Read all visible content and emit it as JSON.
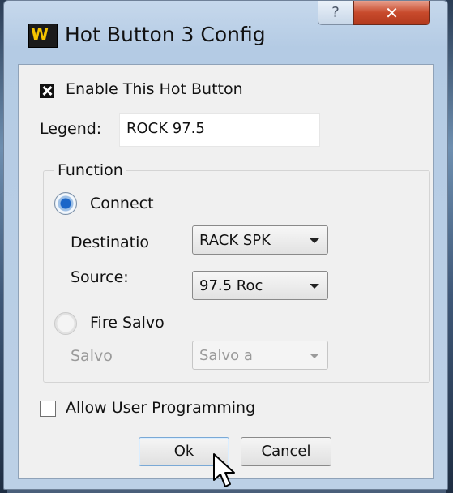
{
  "window": {
    "title": "Hot Button 3 Config",
    "icon_name": "app-logo-icon",
    "help_glyph": "?",
    "close_glyph": "✕"
  },
  "enable": {
    "label": "Enable This Hot Button",
    "checked": true
  },
  "legend": {
    "label": "Legend:",
    "value": "ROCK 97.5"
  },
  "function_group": {
    "title": "Function",
    "connect": {
      "label": "Connect",
      "selected": true,
      "destination": {
        "label": "Destinatio",
        "value": "RACK SPK"
      },
      "source": {
        "label": "Source:",
        "value": "97.5 Roc"
      }
    },
    "fire_salvo": {
      "label": "Fire Salvo",
      "selected": false,
      "salvo": {
        "label": "Salvo",
        "value": "Salvo  a"
      }
    }
  },
  "allow_programming": {
    "label": "Allow User Programming",
    "checked": false
  },
  "buttons": {
    "ok": "Ok",
    "cancel": "Cancel"
  },
  "colors": {
    "close_button": "#c84a2c",
    "radio_selected": "#1b66c8",
    "logo_yellow": "#f5c400"
  }
}
